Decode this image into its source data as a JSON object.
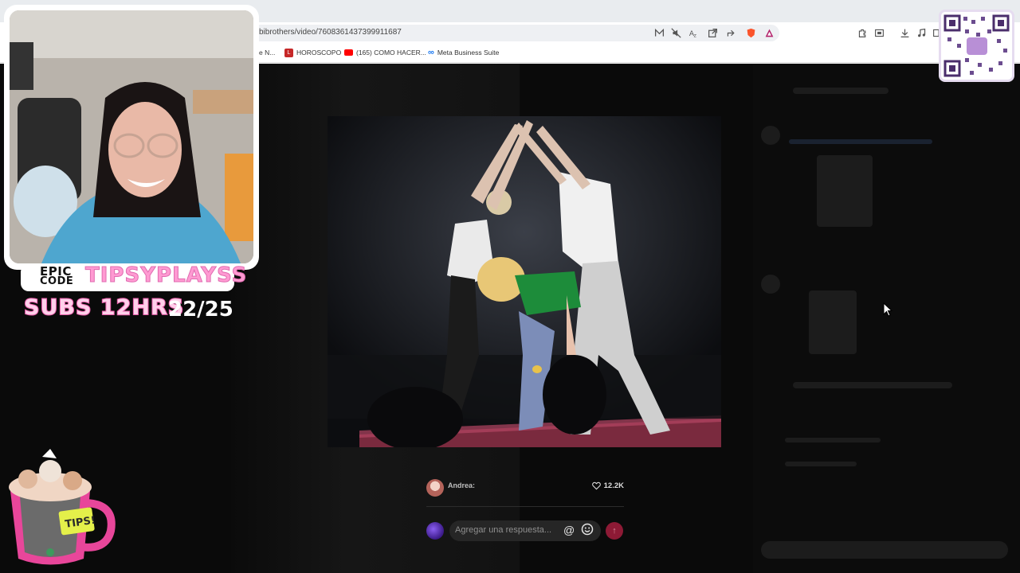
{
  "browser": {
    "url": "bibrothers/video/7608361437399911687",
    "toolbar_icons": [
      "reader-mode-icon",
      "mute-icon",
      "translate-icon",
      "open-external-icon",
      "share-icon",
      "brave-shield-icon",
      "rewards-icon",
      "extensions-icon",
      "screenshot-icon",
      "download-icon",
      "media-icon",
      "sidebar-icon"
    ],
    "bookmarks": [
      {
        "label": "e N...",
        "icon": "generic"
      },
      {
        "label": "HOROSCOPO",
        "icon": "letter-l",
        "color": "#c62828"
      },
      {
        "label": "(165) COMO HACER...",
        "icon": "youtube",
        "color": "#ff0000"
      },
      {
        "label": "Meta Business Suite",
        "icon": "meta",
        "color": "#1877f2"
      }
    ]
  },
  "comment": {
    "author": "Andrea:",
    "likes": "12.2K"
  },
  "reply": {
    "placeholder": "Agregar una respuesta...",
    "mention_symbol": "@",
    "accent_color": "#8d1a35"
  },
  "overlay": {
    "epic": "EPIC",
    "code": "CODE",
    "brand": "TIPSYPLAYSS",
    "subs_label": "SUBS 12HRS",
    "subs_count": "22/25",
    "mug_label": "TIPS!"
  },
  "colors": {
    "brand_pink": "#ff9ad2",
    "brand_stroke": "#e85aa8"
  }
}
